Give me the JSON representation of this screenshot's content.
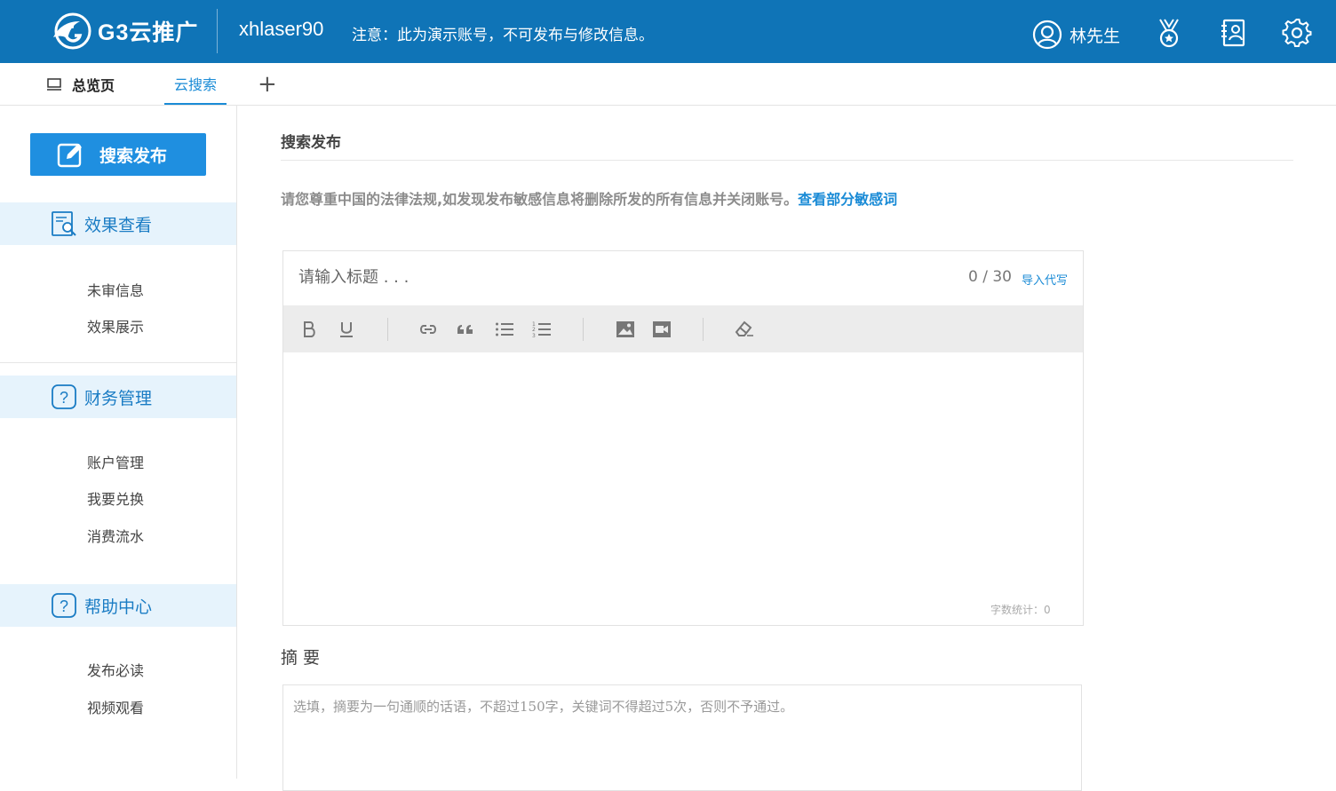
{
  "header": {
    "logo_text": "G3云推广",
    "account": "xhlaser90",
    "notice": "注意：此为演示账号，不可发布与修改信息。",
    "user_name": "林先生",
    "icons": [
      "user-icon",
      "medal-icon",
      "contacts-icon",
      "gear-icon"
    ]
  },
  "tabs": {
    "home": "总览页",
    "search": "云搜索",
    "add": "+"
  },
  "sidebar": {
    "publish_button": "搜索发布",
    "sections": [
      {
        "title": "效果查看",
        "icon": "report-search-icon",
        "items": [
          "未审信息",
          "效果展示"
        ]
      },
      {
        "title": "财务管理",
        "icon": "question-icon",
        "items": [
          "账户管理",
          "我要兑换",
          "消费流水"
        ]
      },
      {
        "title": "帮助中心",
        "icon": "question-icon",
        "items": [
          "发布必读",
          "视频观看"
        ]
      }
    ]
  },
  "main": {
    "page_title": "搜索发布",
    "warning_text": "请您尊重中国的法律法规,如发现发布敏感信息将删除所发的所有信息并关闭账号。",
    "warning_link": "查看部分敏感词",
    "editor": {
      "title_placeholder": "请输入标题 . . .",
      "counter": "0 / 30",
      "import_link": "导入代写",
      "word_count": "字数统计：0",
      "toolbar": [
        "bold-icon",
        "underline-icon",
        "link-icon",
        "quote-icon",
        "bullet-list-icon",
        "numbered-list-icon",
        "image-icon",
        "video-icon",
        "eraser-icon"
      ]
    },
    "summary_label": "摘 要",
    "summary_placeholder": "选填，摘要为一句通顺的话语，不超过150字，关键词不得超过5次，否则不予通过。"
  },
  "colors": {
    "header_bg": "#0f74b7",
    "accent": "#1a8bd6",
    "button": "#1f8fe0",
    "section_bg": "#e6f3fc"
  }
}
